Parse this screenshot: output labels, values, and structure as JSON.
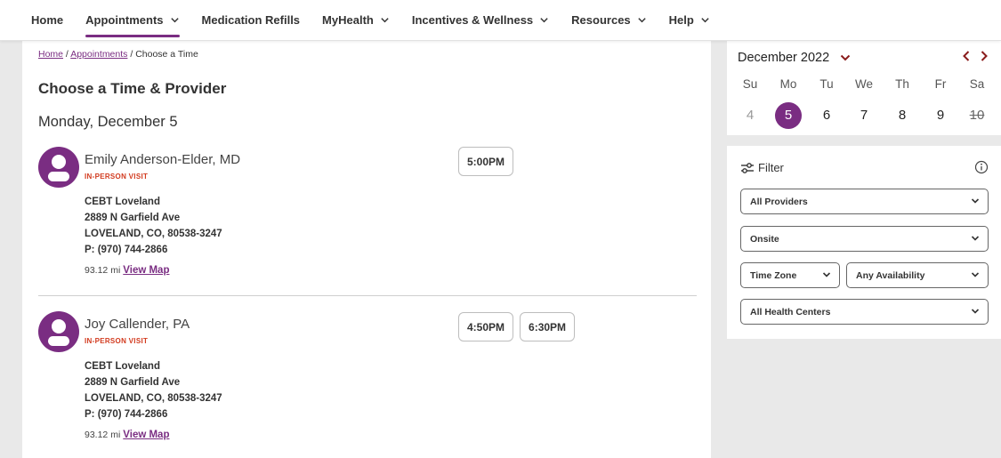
{
  "nav": {
    "items": [
      {
        "label": "Home",
        "chevron": false
      },
      {
        "label": "Appointments",
        "chevron": true,
        "active": true
      },
      {
        "label": "Medication Refills",
        "chevron": false
      },
      {
        "label": "MyHealth",
        "chevron": true
      },
      {
        "label": "Incentives & Wellness",
        "chevron": true
      },
      {
        "label": "Resources",
        "chevron": true
      },
      {
        "label": "Help",
        "chevron": true
      }
    ]
  },
  "breadcrumb": {
    "home": "Home",
    "sep1": " / ",
    "appointments": "Appointments",
    "sep2": " / ",
    "current": "Choose a Time"
  },
  "page_title": "Choose a Time & Provider",
  "date_heading": "Monday, December 5",
  "providers": [
    {
      "name": "Emily Anderson-Elder, MD",
      "visit_type": "IN-PERSON VISIT",
      "location": "CEBT Loveland",
      "street": "2889 N Garfield Ave",
      "city": "LOVELAND, CO, 80538-3247",
      "phone": "P: (970) 744-2866",
      "distance": "93.12 mi",
      "map_link": "View Map",
      "times": [
        "5:00PM"
      ]
    },
    {
      "name": "Joy Callender, PA",
      "visit_type": "IN-PERSON VISIT",
      "location": "CEBT Loveland",
      "street": "2889 N Garfield Ave",
      "city": "LOVELAND, CO, 80538-3247",
      "phone": "P: (970) 744-2866",
      "distance": "93.12 mi",
      "map_link": "View Map",
      "times": [
        "4:50PM",
        "6:30PM"
      ]
    }
  ],
  "calendar": {
    "month": "December 2022",
    "weekdays": [
      "Su",
      "Mo",
      "Tu",
      "We",
      "Th",
      "Fr",
      "Sa"
    ],
    "days": [
      {
        "label": "4",
        "state": "past"
      },
      {
        "label": "5",
        "state": "selected"
      },
      {
        "label": "6",
        "state": "normal"
      },
      {
        "label": "7",
        "state": "normal"
      },
      {
        "label": "8",
        "state": "normal"
      },
      {
        "label": "9",
        "state": "normal"
      },
      {
        "label": "10",
        "state": "unavailable"
      }
    ]
  },
  "filter": {
    "title": "Filter",
    "providers": "All Providers",
    "visit_mode": "Onsite",
    "time_zone": "Time Zone",
    "availability": "Any Availability",
    "health_centers": "All Health Centers"
  },
  "colors": {
    "accent": "#7a2d82",
    "visit_type": "#d23a1e",
    "calendar_chevron": "#8a1c1c"
  },
  "icons": {
    "nav_dropdown": "chevron-down-icon",
    "avatar": "user-icon",
    "filter": "sliders-icon",
    "info": "info-icon"
  }
}
